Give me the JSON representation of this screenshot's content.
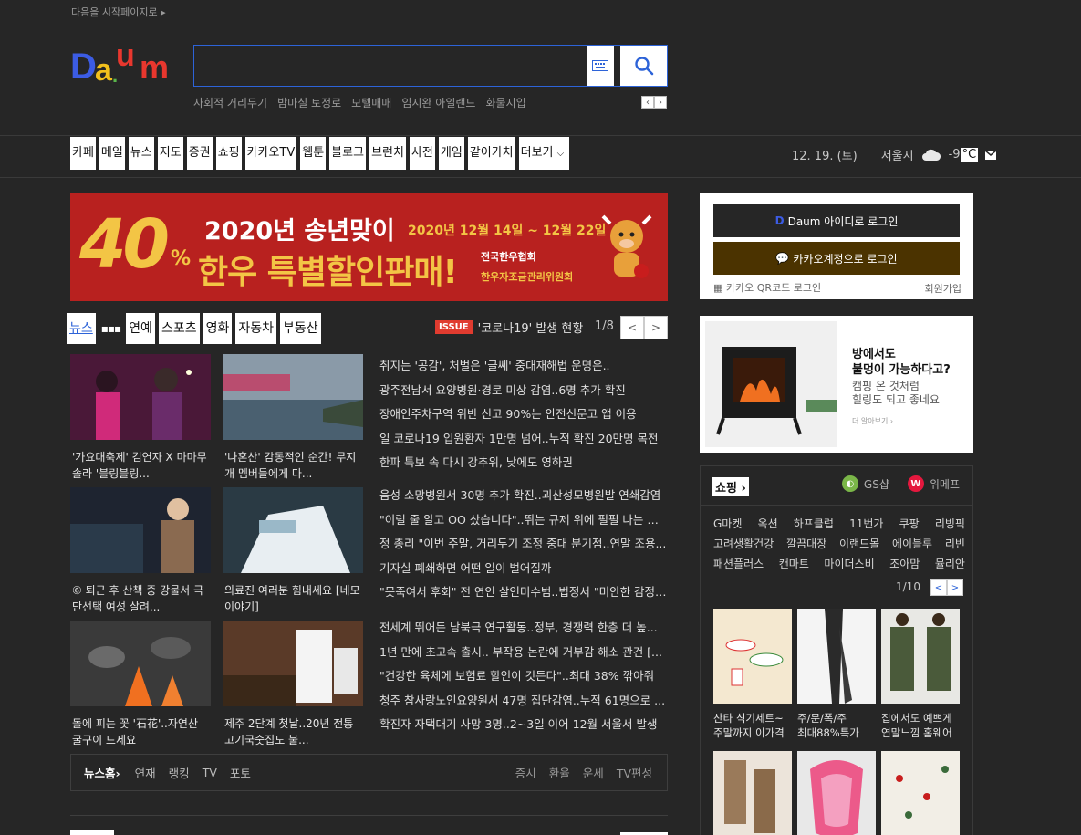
{
  "top_link": "다음을 시작페이지로 ▸",
  "search": {
    "placeholder": "",
    "trends": [
      "사회적 거리두기",
      "밤마실 토정로",
      "모텔매매",
      "임시완 아일랜드",
      "화물지입"
    ],
    "trend_prev": "‹",
    "trend_next": "›"
  },
  "gnb": [
    "카페",
    "메일",
    "뉴스",
    "지도",
    "증권",
    "쇼핑",
    "카카오TV",
    "웹툰",
    "블로그",
    "브런치",
    "사전",
    "게임",
    "같이가치",
    "더보기"
  ],
  "date": "12. 19. (토)",
  "weather": {
    "city": "서울시",
    "temp": "-9",
    "unit": "°C"
  },
  "banner": {
    "big": "40",
    "pct": "%",
    "title": "2020년 송년맞이",
    "date": "2020년 12월 14일 ~ 12월 22일",
    "sub": "한우 특별할인판매!",
    "org1": "전국한우협회",
    "org2": "한우자조금관리위원회"
  },
  "news_tabs": [
    "뉴스",
    "연예",
    "스포츠",
    "영화",
    "자동차",
    "부동산"
  ],
  "issue": {
    "badge": "ISSUE",
    "text": "'코로나19' 발생 현황",
    "page": "1/8"
  },
  "thumbs": [
    {
      "cap": "'가요대축제' 김연자 X 마마무 솔라 '블링블링..."
    },
    {
      "cap": "'나혼산' 감동적인 순간! 무지개 멤버들에게 다..."
    },
    {
      "cap": "⑥ 퇴근 후 산책 중 강물서 극단선택 여성 살려..."
    },
    {
      "cap": "의료진 여러분 힘내세요 [네모이야기]"
    },
    {
      "cap": "돌에 피는 꽃 '石花'..자연산 굴구이 드세요"
    },
    {
      "cap": "제주 2단계 첫날..20년 전통 고기국숫집도 불..."
    }
  ],
  "headlines_1": [
    "취지는 '공감', 처벌은 '글쎄' 중대재해법 운명은..",
    "광주전남서 요양병원·경로 미상 감염..6명 추가 확진",
    "장애인주차구역 위반 신고 90%는 안전신문고 앱 이용",
    "일 코로나19 입원환자 1만명 넘어..누적 확진 20만명 목전",
    "한파 특보 속 다시 강추위, 낮에도 영하권"
  ],
  "headlines_2": [
    "음성 소망병원서 30명 추가 확진..괴산성모병원발 연쇄감염",
    "\"이럴 줄 알고 OO 샀습니다\"..뛰는 규제 위에 펄펄 나는 시장",
    "정 총리 \"이번 주말, 거리두기 조정 중대 분기점..연말 조용...",
    "기자실 폐쇄하면 어떤 일이 벌어질까",
    "\"못죽여서 후회\" 전 연인 살인미수범..법정서 \"미안한 감정 ..."
  ],
  "headlines_3": [
    "전세계 뛰어든 남북극 연구활동..정부, 경쟁력 한층 더 높...",
    "1년 만에 초고속 출시.. 부작용 논란에 거부감 해소 관건 [...",
    "\"건강한 육체에 보험료 할인이 깃든다\"..최대 38% 깎아줘",
    "청주 참사랑노인요양원서 47명 집단감염..누적 61명으로 ...",
    "확진자 자택대기 사망 3명..2~3일 이어 12월 서울서 발생"
  ],
  "news_footer": {
    "home": "뉴스홈›",
    "left": [
      "연재",
      "랭킹",
      "TV",
      "포토"
    ],
    "right": [
      "증시",
      "환율",
      "운세",
      "TV편성"
    ]
  },
  "login": {
    "daum": "Daum 아이디로 로그인",
    "kakao": "카카오계정으로 로그인",
    "qr": "카카오 QR코드 로그인",
    "join": "회원가입"
  },
  "ad": {
    "t1": "방에서도 불멍이 가능하다고?",
    "t1a": "방에서도",
    "t1b": "불멍이 가능하다고?",
    "t2a": "캠핑 온 것처럼",
    "t2b": "힐링도 되고 좋네요",
    "more": "더 알아보기 ›"
  },
  "shop": {
    "title": "쇼핑 ›",
    "partners": [
      "GS샵",
      "위메프"
    ],
    "links": [
      [
        "G마켓",
        "옥션",
        "하프클럽",
        "11번가",
        "쿠팡",
        "리빙픽"
      ],
      [
        "고려생활건강",
        "깔끔대장",
        "이랜드몰",
        "에이블루",
        "리빈"
      ],
      [
        "패션플러스",
        "캔마트",
        "마이더스비",
        "조아맘",
        "뮬리안"
      ]
    ],
    "page": "1/10",
    "items": [
      {
        "cap1": "산타 식기세트~",
        "cap2": "주말까지 이가격"
      },
      {
        "cap1": "주/문/폭/주",
        "cap2": "최대88%특가"
      },
      {
        "cap1": "집에서도 예쁘게",
        "cap2": "연말느낌 홈웨어"
      }
    ]
  }
}
